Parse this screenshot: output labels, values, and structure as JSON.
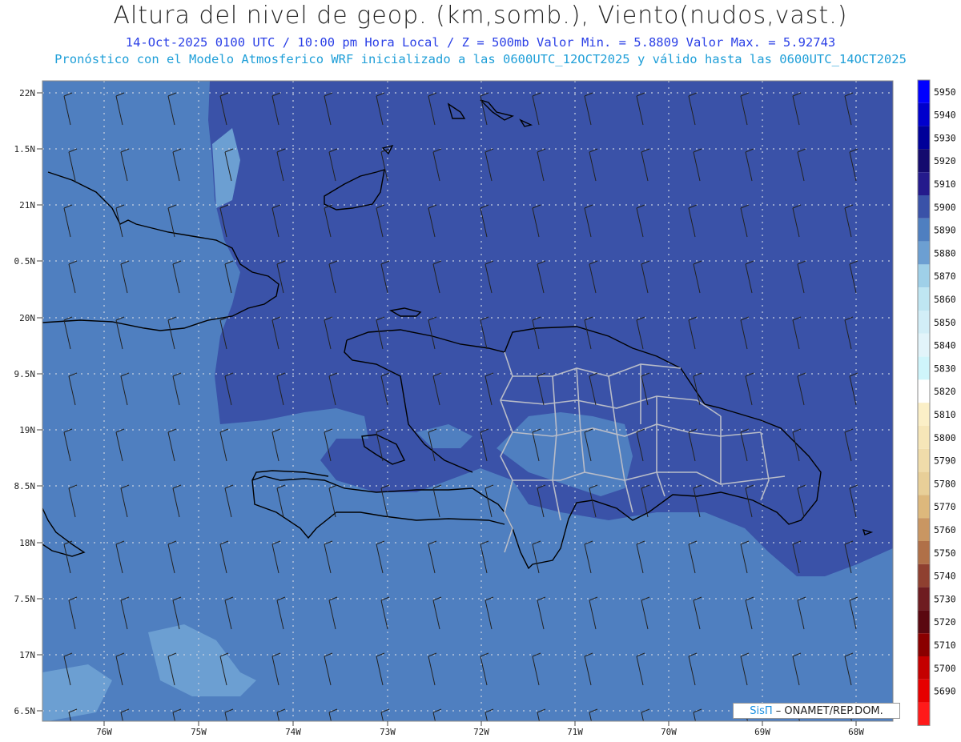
{
  "header": {
    "title": "Altura del nivel de geop. (km,somb.), Viento(nudos,vast.)",
    "subtitle": "14-Oct-2025  0100 UTC / 10:00 pm Hora Local / Z = 500mb     Valor Min. = 5.8809   Valor Max. = 5.92743",
    "model_line": "Pronóstico con el Modelo Atmosferico WRF inicializado a las 0600UTC_12OCT2025 y válido hasta las  0600UTC_14OCT2025"
  },
  "axes": {
    "lat_labels": [
      "22N",
      "1.5N",
      "21N",
      "0.5N",
      "20N",
      "9.5N",
      "19N",
      "8.5N",
      "18N",
      "7.5N",
      "17N",
      "6.5N"
    ],
    "lon_labels": [
      "76W",
      "75W",
      "74W",
      "73W",
      "72W",
      "71W",
      "70W",
      "69W",
      "68W"
    ]
  },
  "colorbar": {
    "levels": [
      "5950",
      "5940",
      "5930",
      "5920",
      "5910",
      "5900",
      "5890",
      "5880",
      "5870",
      "5860",
      "5850",
      "5840",
      "5830",
      "5820",
      "5810",
      "5800",
      "5790",
      "5780",
      "5770",
      "5760",
      "5750",
      "5740",
      "5730",
      "5720",
      "5710",
      "5700",
      "5690"
    ],
    "colors": [
      "#0000ff",
      "#0000cc",
      "#000099",
      "#140a6e",
      "#241a8c",
      "#3a52a8",
      "#4f7fc0",
      "#6c9fd2",
      "#9fd0e8",
      "#bfe6f2",
      "#d2eef7",
      "#e2f4fa",
      "#cff5fb",
      "#ffffff",
      "#fbefc7",
      "#f6e6b8",
      "#f0dcaa",
      "#e8cf98",
      "#ddb87c",
      "#c99662",
      "#b07048",
      "#8f4030",
      "#6e1c20",
      "#5a0810",
      "#8a0000",
      "#c40000",
      "#e60000",
      "#ff1a1a"
    ]
  },
  "credit": {
    "brand": "SisΠ",
    "text": " – ONAMET/REP.DOM."
  },
  "field_colors": {
    "z5890": "#4f7fc0",
    "z5900": "#3a52a8",
    "z5880": "#6c9fd2"
  }
}
